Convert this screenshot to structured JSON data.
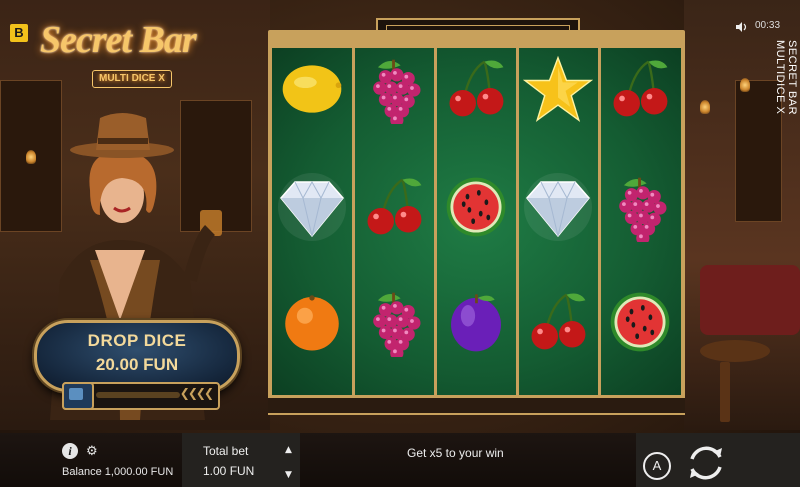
{
  "brand": {
    "badge": "B",
    "title": "Secret Bar",
    "subtitle": "MULTI DICE X"
  },
  "status": {
    "time": "00:33",
    "side_title": "SECRET BAR MULTIDICE X"
  },
  "drop_dice": {
    "title": "DROP DICE",
    "value": "20.00 FUN",
    "progress": 0.05
  },
  "reels": {
    "columns": [
      [
        "lemon",
        "diamond",
        "orange"
      ],
      [
        "grapes",
        "cherries",
        "grapes"
      ],
      [
        "cherries",
        "watermelon",
        "plum"
      ],
      [
        "star",
        "diamond",
        "cherries"
      ],
      [
        "cherries",
        "grapes",
        "watermelon"
      ]
    ]
  },
  "footer": {
    "balance": "Balance 1,000.00 FUN",
    "bet_label": "Total bet",
    "bet_value": "1.00 FUN",
    "promo": "Get x5 to your win",
    "auto_label": "A"
  },
  "icons": {
    "info": "info-icon",
    "settings": "gear-icon",
    "sound": "speaker-icon",
    "spin": "spin-icon",
    "bet_up": "up-arrow-icon",
    "bet_down": "down-arrow-icon"
  },
  "colors": {
    "gold": "#c8a15c",
    "felt": "#145c32",
    "panel_blue": "#16283e"
  }
}
